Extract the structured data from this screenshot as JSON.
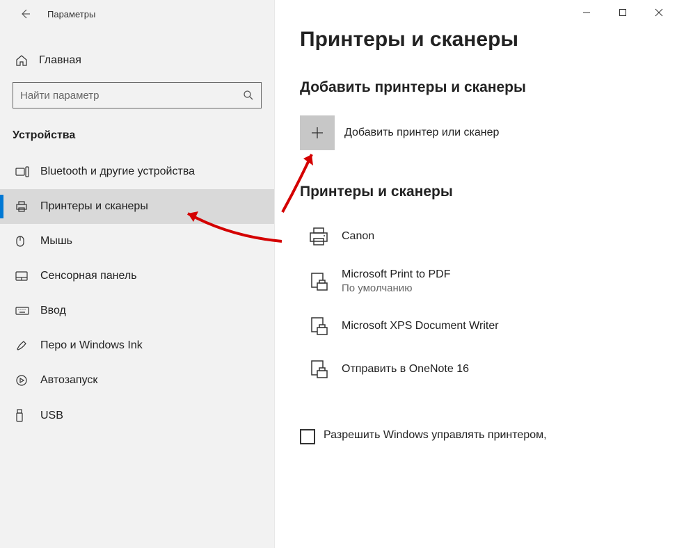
{
  "titlebar": {
    "title": "Параметры"
  },
  "sidebar": {
    "home": "Главная",
    "search_placeholder": "Найти параметр",
    "section": "Устройства",
    "items": [
      {
        "label": "Bluetooth и другие устройства"
      },
      {
        "label": "Принтеры и сканеры"
      },
      {
        "label": "Мышь"
      },
      {
        "label": "Сенсорная панель"
      },
      {
        "label": "Ввод"
      },
      {
        "label": "Перо и Windows Ink"
      },
      {
        "label": "Автозапуск"
      },
      {
        "label": "USB"
      }
    ]
  },
  "content": {
    "heading": "Принтеры и сканеры",
    "add_section": "Добавить принтеры и сканеры",
    "add_label": "Добавить принтер или сканер",
    "list_section": "Принтеры и сканеры",
    "devices": [
      {
        "name": "Canon",
        "sub": ""
      },
      {
        "name": "Microsoft Print to PDF",
        "sub": "По умолчанию"
      },
      {
        "name": "Microsoft XPS Document Writer",
        "sub": ""
      },
      {
        "name": "Отправить в OneNote 16",
        "sub": ""
      }
    ],
    "checkbox_label": "Разрешить Windows управлять принтером,"
  }
}
